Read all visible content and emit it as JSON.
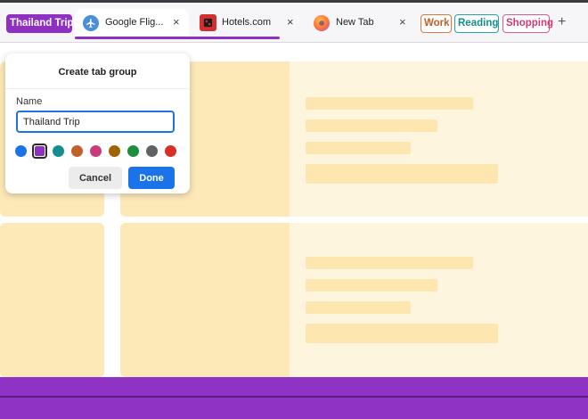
{
  "tab_strip": {
    "active_group": {
      "label": "Thailand Trip",
      "color": "#8e31c2"
    },
    "tabs": [
      {
        "title": "Google Flig...",
        "icon": "airplane-icon",
        "icon_color": "#4a90d9",
        "active": true,
        "close_label": "×"
      },
      {
        "title": "Hotels.com",
        "icon": "hotels-logo-icon",
        "icon_color": "#d32f2f",
        "active": false,
        "close_label": "×"
      },
      {
        "title": "New Tab",
        "icon": "firefox-icon",
        "icon_color": "#ff7139",
        "active": false,
        "close_label": "×"
      }
    ],
    "other_groups": [
      {
        "label": "Work",
        "color": "#d87a3c"
      },
      {
        "label": "Reading",
        "color": "#2aa3a3"
      },
      {
        "label": "Shopping",
        "color": "#dd5a92"
      }
    ],
    "new_tab_label": "+"
  },
  "dialog": {
    "title": "Create tab group",
    "name_label": "Name",
    "name_value": "Thailand Trip",
    "colors": [
      "#1a73e8",
      "#8e31c2",
      "#138d8d",
      "#c0612a",
      "#cc3a79",
      "#a06400",
      "#1e8e3e",
      "#5f6368",
      "#d93025"
    ],
    "selected_color_index": 1,
    "cancel_label": "Cancel",
    "done_label": "Done"
  }
}
